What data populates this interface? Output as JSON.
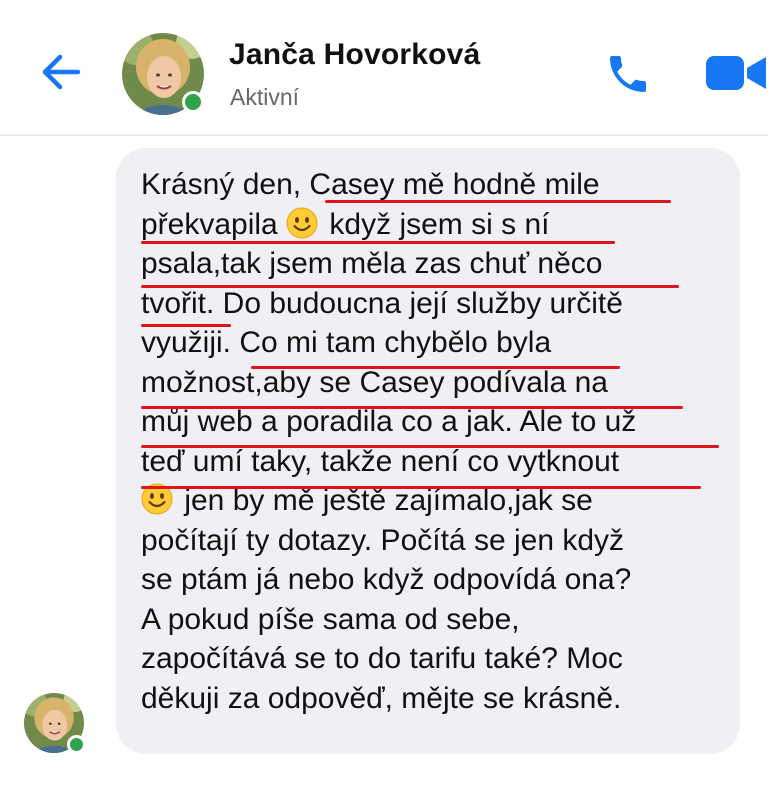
{
  "header": {
    "back_icon": "arrow-left-icon",
    "contact_name": "Janča Hovorková",
    "contact_status": "Aktivní",
    "call_icon": "phone-icon",
    "video_icon": "video-camera-icon",
    "accent_color": "#1877f2",
    "online_color": "#31a24c"
  },
  "message": {
    "lines": [
      "Krásný den, Casey mě hodně mile",
      "překvapila",
      " když jsem si s ní",
      "psala,tak jsem měla zas chuť něco",
      "tvořit. Do budoucna její služby určitě",
      "využiji. Co mi tam chybělo byla",
      "možnost,aby se Casey podívala na",
      "můj web a poradila co a jak. Ale to už",
      "teď umí taky, takže není co vytknout",
      " jen by mě ještě zajímalo,jak se",
      "počítají ty dotazy. Počítá se jen když",
      "se ptám já nebo když odpovídá ona?",
      "A pokud píše sama od sebe,",
      "započítává se to do tarifu také? Moc",
      "děkuji za odpověď, mějte se krásně."
    ],
    "emoji_icon": "smiling-face-emoji",
    "bubble_color": "#f0f0f4",
    "underline_color": "#e0141c"
  }
}
